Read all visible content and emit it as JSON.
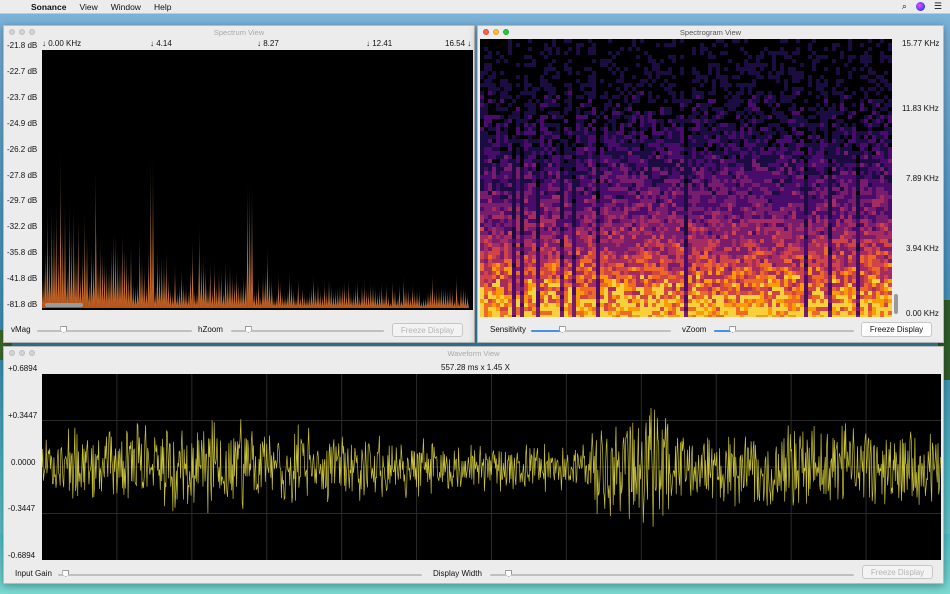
{
  "menubar": {
    "apple": "",
    "app": "Sonance",
    "items": [
      "View",
      "Window",
      "Help"
    ],
    "search_icon": "⌕",
    "list_icon": "☰"
  },
  "spectrum": {
    "title": "Spectrum View",
    "freq_labels": [
      "↓ 0.00 KHz",
      "↓ 4.14",
      "↓ 8.27",
      "↓ 12.41",
      "16.54 ↓"
    ],
    "db_labels": [
      "-21.8 dB",
      "-22.7 dB",
      "-23.7 dB",
      "-24.9 dB",
      "-26.2 dB",
      "-27.8 dB",
      "-29.7 dB",
      "-32.2 dB",
      "-35.8 dB",
      "-41.8 dB",
      "-81.8 dB"
    ],
    "vmag_label": "vMag",
    "hzoom_label": "hZoom",
    "freeze_label": "Freeze Display",
    "vmag_value": 0.17,
    "hzoom_value": 0.11
  },
  "spectrogram": {
    "title": "Spectrogram View",
    "freq_labels": [
      "15.77 KHz",
      "11.83 KHz",
      "7.89 KHz",
      "3.94 KHz",
      "0.00 KHz"
    ],
    "sensitivity_label": "Sensitivity",
    "vzoom_label": "vZoom",
    "freeze_label": "Freeze Display",
    "sensitivity_value": 0.22,
    "vzoom_value": 0.13
  },
  "waveform": {
    "title": "Waveform View",
    "readout": "557.28 ms x 1.45 X",
    "amp_labels": [
      "+0.6894",
      "+0.3447",
      "0.0000",
      "-0.3447",
      "-0.6894"
    ],
    "input_gain_label": "Input Gain",
    "display_width_label": "Display Width",
    "freeze_label": "Freeze Display",
    "input_gain_value": 0.02,
    "display_width_value": 0.05
  },
  "colors": {
    "spectrum_peak": "#fff2d0",
    "spectrum_base": "#c2581a",
    "waveform": "#c9c23a",
    "accent": "#4a90e2"
  }
}
